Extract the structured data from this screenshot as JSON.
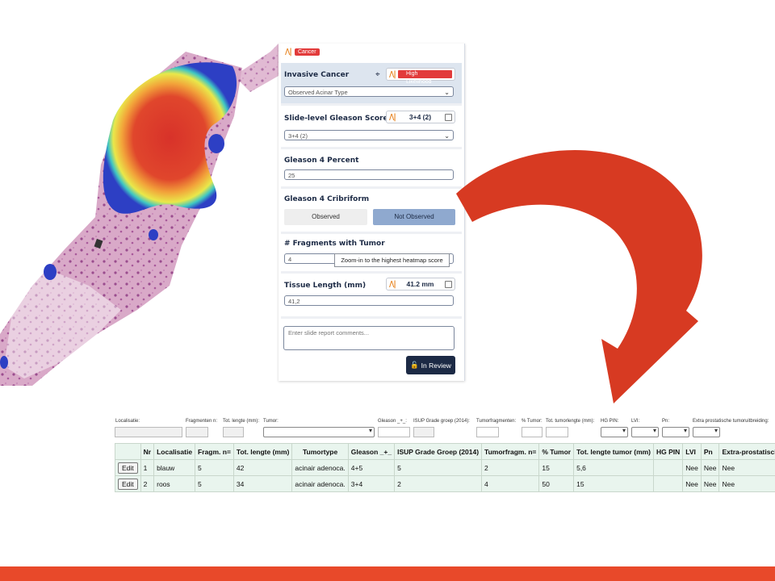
{
  "panel": {
    "brand_tag": "Cancer",
    "invasive": {
      "title": "Invasive Cancer",
      "chip_label": "High Likelihood",
      "select_value": "Observed Acinar Type"
    },
    "gleason": {
      "title": "Slide-level Gleason Score",
      "chip_value": "3+4 (2)",
      "select_value": "3+4 (2)"
    },
    "gleason4pct": {
      "title": "Gleason 4 Percent",
      "value": "25"
    },
    "cribriform": {
      "title": "Gleason 4 Cribriform",
      "observed": "Observed",
      "not_observed": "Not Observed"
    },
    "fragments": {
      "title": "# Fragments with Tumor",
      "value": "4",
      "tooltip": "Zoom-in to the highest heatmap score"
    },
    "tissue_length": {
      "title": "Tissue Length (mm)",
      "chip_value": "41.2 mm",
      "value": "41,2"
    },
    "comment_placeholder": "Enter slide report comments...",
    "review_button": "In Review"
  },
  "lis": {
    "form_labels": {
      "localisatie": "Localisatie:",
      "fragmenten": "Fragmenten n:",
      "tot_lengte": "Tot. lengte (mm):",
      "tumor": "Tumor:",
      "gleason": "Gleason _+_:",
      "isup": "ISUP Grade groep (2014):",
      "tumorfragmenten": "Tumorfragmenten:",
      "pct_tumor": "% Tumor:",
      "tot_tumorlengte": "Tot. tumorlengte (mm):",
      "hg_pin": "HG PIN:",
      "lvi": "LVI:",
      "pn": "Pn:",
      "extra": "Extra prostatische tumoruitbreiding:"
    },
    "columns": [
      "",
      "Nr",
      "Localisatie",
      "Fragm. n=",
      "Tot. lengte (mm)",
      "Tumortype",
      "Gleason _+_",
      "ISUP Grade Groep (2014)",
      "Tumorfragm. n=",
      "% Tumor",
      "Tot. lengte tumor (mm)",
      "HG PIN",
      "LVI",
      "Pn",
      "Extra-prostatische tu"
    ],
    "edit_label": "Edit",
    "rows": [
      {
        "nr": "1",
        "loc": "blauw",
        "fragm": "5",
        "len": "42",
        "type": "acinair adenoca.",
        "gleason": "4+5",
        "isup": "5",
        "tfragm": "2",
        "pct": "15",
        "tlen": "5,6",
        "hgpin": "",
        "lvi": "Nee",
        "pn": "Nee",
        "extra": "Nee"
      },
      {
        "nr": "2",
        "loc": "roos",
        "fragm": "5",
        "len": "34",
        "type": "acinair adenoca.",
        "gleason": "3+4",
        "isup": "2",
        "tfragm": "4",
        "pct": "50",
        "tlen": "15",
        "hgpin": "",
        "lvi": "Nee",
        "pn": "Nee",
        "extra": "Nee"
      }
    ]
  },
  "colors": {
    "accent_red": "#e23b3b",
    "arrow_red": "#d73a22",
    "footer_bar": "#e8492a",
    "button_navy": "#1c2a45",
    "selected_blue": "#8fa9cf"
  }
}
